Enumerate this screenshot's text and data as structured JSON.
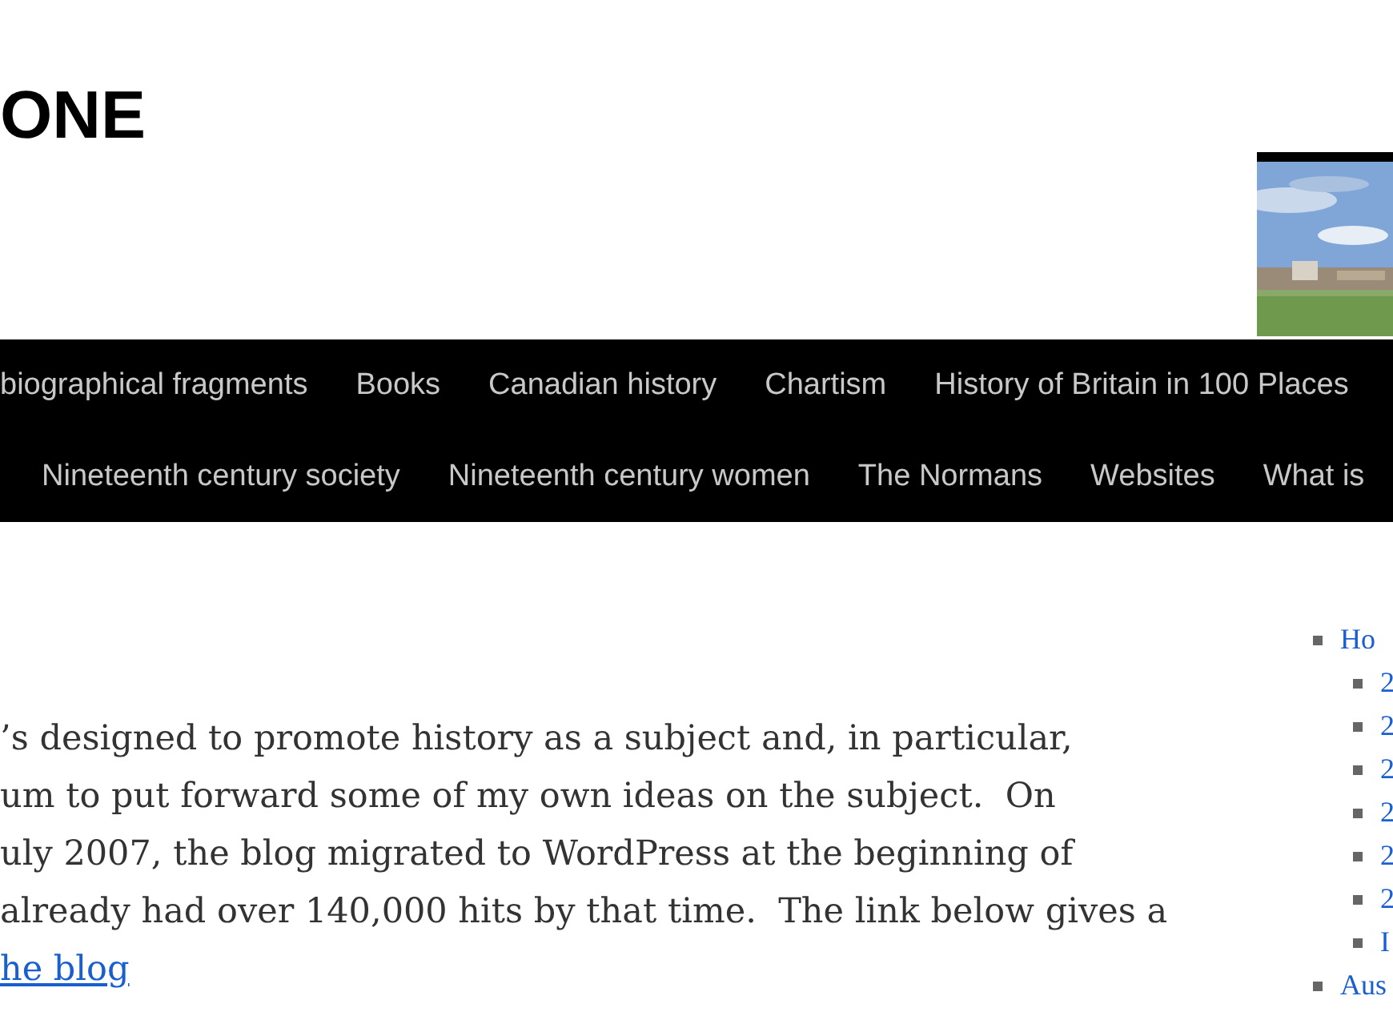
{
  "site_title": "ONE",
  "nav_rows": [
    [
      "biographical fragments",
      "Books",
      "Canadian history",
      "Chartism",
      "History of Britain in 100 Places"
    ],
    [
      "Nineteenth century society",
      "Nineteenth century women",
      "The Normans",
      "Websites",
      "What is"
    ]
  ],
  "intro": {
    "lines": [
      "’s designed to promote history as a subject and, in particular,",
      "um to put forward some of my own ideas on the subject.  On",
      "uly 2007, the blog migrated to WordPress at the beginning of",
      "already had over 140,000 hits by that time.  The link below gives a"
    ],
    "link": "he blog"
  },
  "sidebar": {
    "items": [
      {
        "label": "Ho",
        "children": [
          {
            "label": "2"
          },
          {
            "label": "2"
          },
          {
            "label": "2"
          },
          {
            "label": "2"
          },
          {
            "label": "2"
          },
          {
            "label": "2"
          },
          {
            "label": "I"
          }
        ]
      },
      {
        "label": "Aus"
      }
    ]
  }
}
